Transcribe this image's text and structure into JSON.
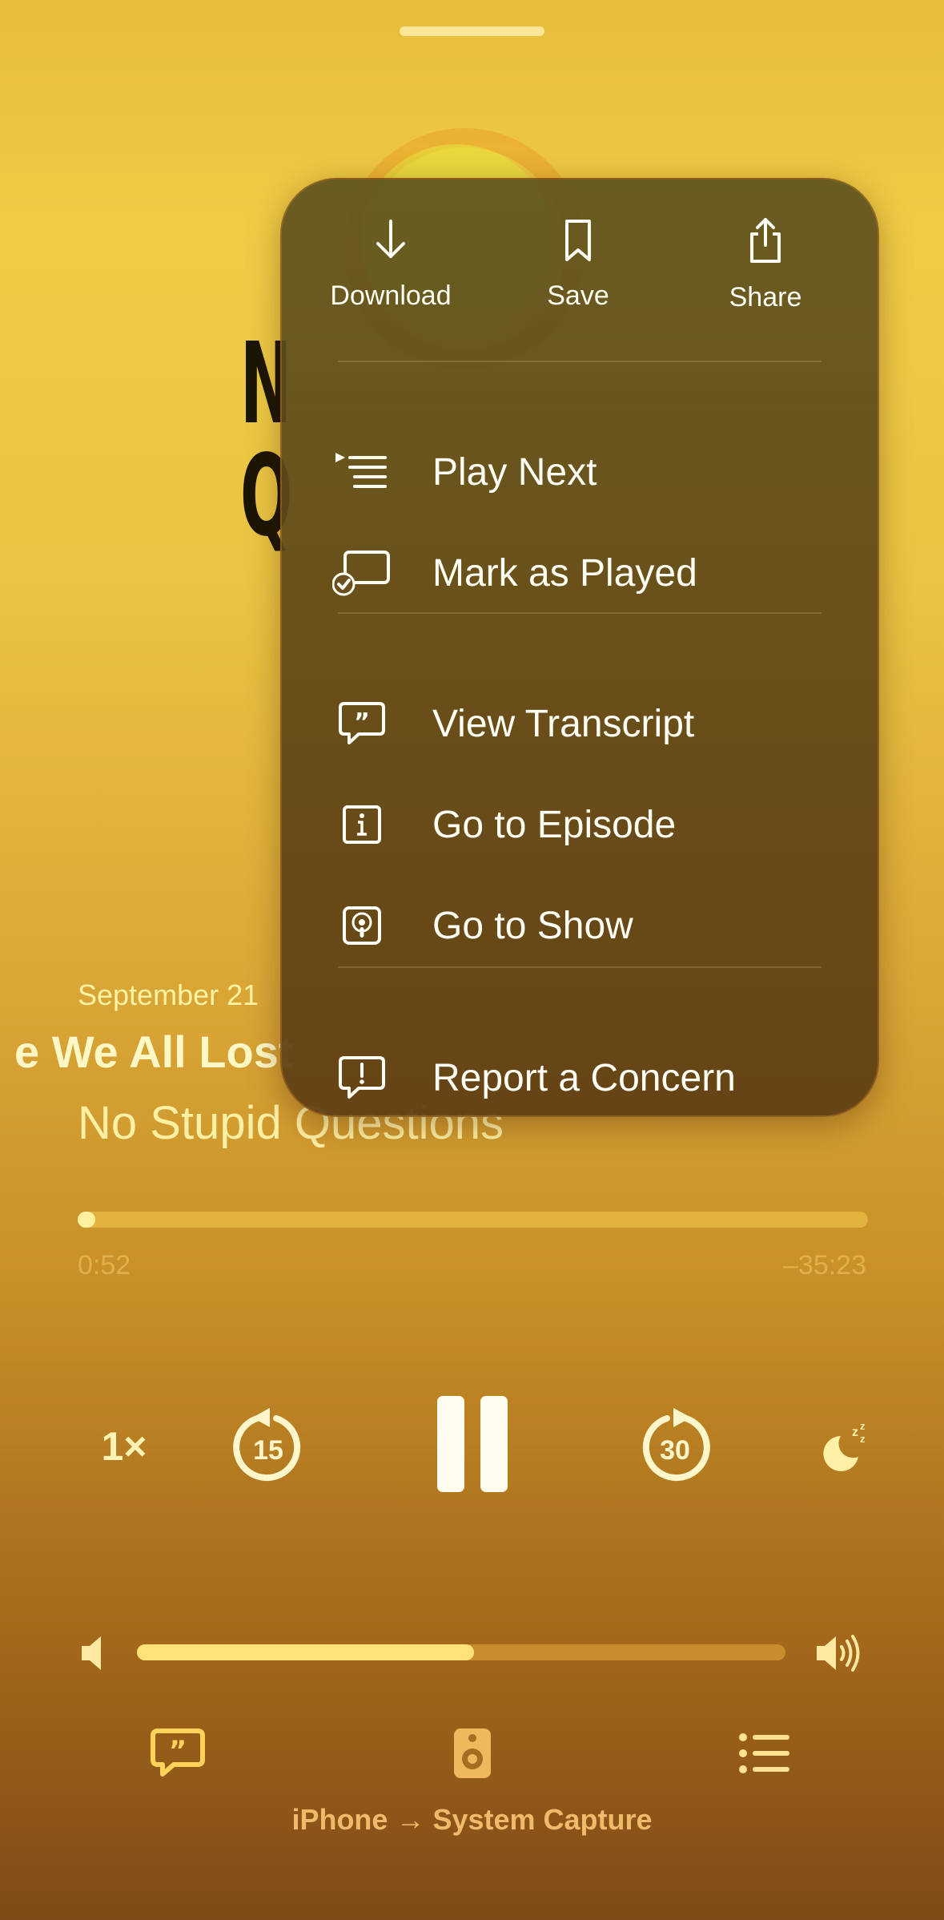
{
  "player": {
    "date": "September 21",
    "episode_title": "e We All Lost",
    "show_title": "No Stupid Questions",
    "elapsed": "0:52",
    "remaining": "–35:23",
    "progress": 0.022,
    "speed": "1×",
    "skip_back_seconds": "15",
    "skip_forward_seconds": "30",
    "volume": 0.52,
    "route": "iPhone → System Capture"
  },
  "menu": {
    "top_actions": [
      {
        "label": "Download",
        "icon": "download-icon"
      },
      {
        "label": "Save",
        "icon": "bookmark-icon"
      },
      {
        "label": "Share",
        "icon": "share-icon"
      }
    ],
    "items": [
      {
        "label": "Play Next",
        "icon": "play-next-icon"
      },
      {
        "label": "Mark as Played",
        "icon": "mark-played-icon"
      },
      {
        "label": "View Transcript",
        "icon": "transcript-icon"
      },
      {
        "label": "Go to Episode",
        "icon": "info-icon"
      },
      {
        "label": "Go to Show",
        "icon": "podcast-icon"
      },
      {
        "label": "Report a Concern",
        "icon": "report-icon"
      }
    ]
  },
  "artwork": {
    "visible_letters": "N\nQ"
  },
  "colors": {
    "accent": "#fff1a0",
    "menu_bg": "#5f4518"
  }
}
